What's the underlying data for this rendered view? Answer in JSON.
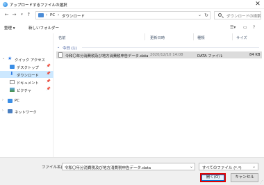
{
  "window": {
    "title": "アップロードするファイルの選択",
    "close_glyph": "✕"
  },
  "address": {
    "crumbs": [
      "PC",
      "ダウンロード"
    ],
    "search_placeholder": "ダウンロードの検索"
  },
  "toolbar": {
    "organize_label": "整理 ▾",
    "new_folder_label": "新しいフォルダー"
  },
  "nav": {
    "items": [
      {
        "label": "クイック アクセス",
        "icon": "star-icon"
      },
      {
        "label": "デスクトップ",
        "icon": "desktop-icon"
      },
      {
        "label": "ダウンロード",
        "icon": "download-icon"
      },
      {
        "label": "ドキュメント",
        "icon": "document-icon"
      },
      {
        "label": "ピクチャ",
        "icon": "pictures-icon"
      },
      {
        "label": "PC",
        "icon": "pc-icon"
      },
      {
        "label": "ネットワーク",
        "icon": "network-icon"
      }
    ]
  },
  "list": {
    "columns": [
      "名前",
      "更新日時",
      "種類",
      "サイズ"
    ],
    "group_label": "今日 (1)",
    "files": [
      {
        "name": "令和〇年分消費税及び地方消費税申告データ.data",
        "modified": "2020/12/10 14:08",
        "type": "DATA ファイル",
        "size": "84 KB"
      }
    ]
  },
  "bottom": {
    "filename_label": "ファイル名(N):",
    "filename_value": "令和〇年分消費税及び地方消費税申告データ.data",
    "filetype_value": "すべてのファイル (*.*)",
    "open_label": "開く(O)",
    "cancel_label": "キャンセル"
  },
  "colors": {
    "selection": "#cce8ff",
    "highlight_border": "#e00000",
    "group_text": "#1a3a8a"
  }
}
